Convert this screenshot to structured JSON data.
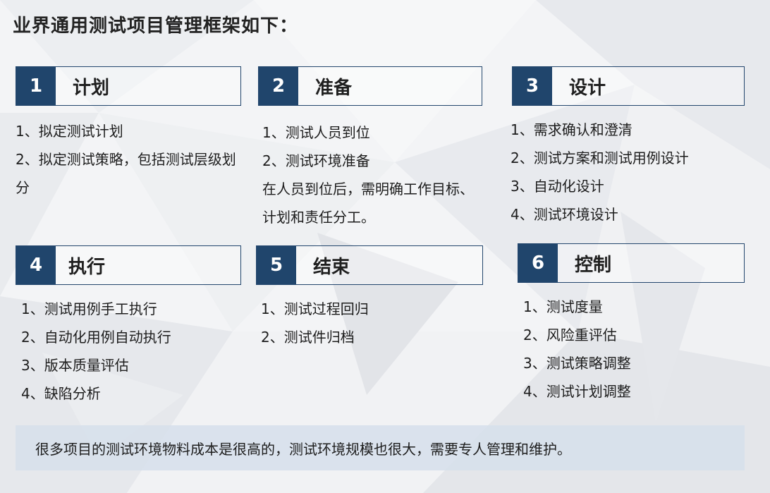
{
  "title": "业界通用测试项目管理框架如下：",
  "colors": {
    "accent": "#20456c",
    "note_bg": "#d6dfeb"
  },
  "sections": [
    {
      "number": "1",
      "label": "计划",
      "items": [
        "1、拟定测试计划",
        "2、拟定测试策略，包括测试层级划分"
      ],
      "note": []
    },
    {
      "number": "2",
      "label": "准备",
      "items": [
        "1、测试人员到位",
        "2、测试环境准备"
      ],
      "note": [
        "在人员到位后，需明确工作目标、",
        "计划和责任分工。"
      ]
    },
    {
      "number": "3",
      "label": "设计",
      "items": [
        "1、需求确认和澄清",
        "2、测试方案和测试用例设计",
        "3、自动化设计",
        "4、测试环境设计"
      ],
      "note": []
    },
    {
      "number": "4",
      "label": "执行",
      "items": [
        "1、测试用例手工执行",
        "2、自动化用例自动执行",
        "3、版本质量评估",
        "4、缺陷分析"
      ],
      "note": []
    },
    {
      "number": "5",
      "label": "结束",
      "items": [
        "1、测试过程回归",
        "2、测试件归档"
      ],
      "note": []
    },
    {
      "number": "6",
      "label": "控制",
      "items": [
        "1、测试度量",
        "2、风险重评估",
        "3、测试策略调整",
        "4、测试计划调整"
      ],
      "note": []
    }
  ],
  "bottom_note": "很多项目的测试环境物料成本是很高的，测试环境规模也很大，需要专人管理和维护。"
}
